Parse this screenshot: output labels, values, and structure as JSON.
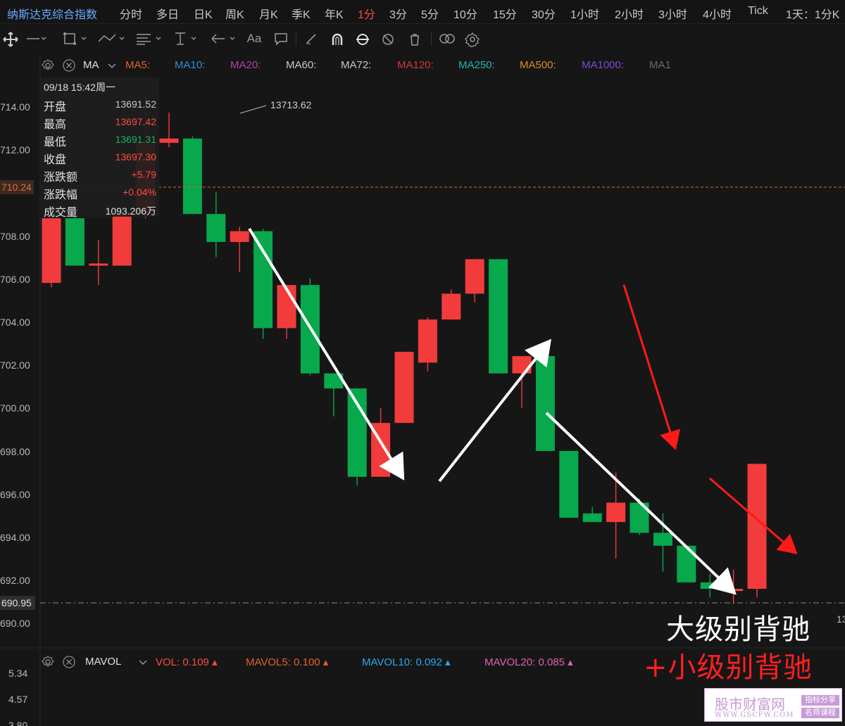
{
  "topbar": {
    "title": "纳斯达克综合指数",
    "timeframes": [
      "分时",
      "多日",
      "日K",
      "周K",
      "月K",
      "季K",
      "年K",
      "1分",
      "3分",
      "5分",
      "10分",
      "15分",
      "30分",
      "1小时",
      "2小时",
      "3小时",
      "4小时",
      "Tick"
    ],
    "active": "1分",
    "extra": "1天：1分K"
  },
  "indicator_legend": {
    "indicator": "MA",
    "items": [
      {
        "label": "MA5:",
        "color": "#e0632a"
      },
      {
        "label": "MA10:",
        "color": "#2f8fd8"
      },
      {
        "label": "MA20:",
        "color": "#b040a8"
      },
      {
        "label": "MA60:",
        "color": "#c8c8c8"
      },
      {
        "label": "MA72:",
        "color": "#c8c8c8"
      },
      {
        "label": "MA120:",
        "color": "#d03a3a"
      },
      {
        "label": "MA250:",
        "color": "#21b3b3"
      },
      {
        "label": "MA500:",
        "color": "#d9901e"
      },
      {
        "label": "MA1000:",
        "color": "#7b4ad8"
      },
      {
        "label": "MA1",
        "color": "#6a6a6a"
      }
    ]
  },
  "infobox": {
    "datetime": "09/18 15:42周一",
    "rows": [
      {
        "label": "开盘",
        "value": "13691.52",
        "color": "#c8c8c8"
      },
      {
        "label": "最高",
        "value": "13697.42",
        "color": "#ff4a3d"
      },
      {
        "label": "最低",
        "value": "13691.31",
        "color": "#19b35a"
      },
      {
        "label": "收盘",
        "value": "13697.30",
        "color": "#ff4a3d"
      },
      {
        "label": "涨跌额",
        "value": "+5.79",
        "color": "#ff4a3d"
      },
      {
        "label": "涨跌幅",
        "value": "+0.04%",
        "color": "#ff4a3d"
      },
      {
        "label": "成交量",
        "value": "1093.206万",
        "color": "#e0e0e0"
      }
    ]
  },
  "price_axis": {
    "ticks": [
      "714.00",
      "712.00",
      "708.00",
      "706.00",
      "704.00",
      "702.00",
      "700.00",
      "698.00",
      "696.00",
      "694.00",
      "692.00",
      "690.00"
    ],
    "current_label": "710.24",
    "last_label": "690.95"
  },
  "high_annotation": "13713.62",
  "volume_axis": [
    "5.34",
    "4.57",
    "3.80"
  ],
  "volume_legend": {
    "indicator": "MAVOL",
    "items": [
      {
        "label": "VOL:",
        "value": "0.109",
        "color": "#ff4a3d"
      },
      {
        "label": "MAVOL5:",
        "value": "0.100",
        "color": "#e0632a"
      },
      {
        "label": "MAVOL10:",
        "value": "0.092",
        "color": "#2aa8e8"
      },
      {
        "label": "MAVOL20:",
        "value": "0.085",
        "color": "#e060b0"
      }
    ]
  },
  "right_edge_label": "13",
  "overlay_text": {
    "line1": "大级别背驰",
    "line2": "+小级别背驰"
  },
  "watermark": {
    "title": "股市财富网",
    "url": "WWW.GSCFW.COM",
    "tag1": "指标分享",
    "tag2": "名师课程"
  },
  "colors": {
    "up": "#f23c3c",
    "down": "#08a84d",
    "background": "#161616"
  },
  "chart_data": {
    "type": "candlestick",
    "price_unit": "last 3 digits of index level",
    "ylim": [
      689.2,
      716.5
    ],
    "candles": [
      {
        "o": 705.8,
        "h": 708.8,
        "l": 705.6,
        "c": 708.8
      },
      {
        "o": 708.8,
        "h": 709.5,
        "l": 706.7,
        "c": 706.6
      },
      {
        "o": 706.6,
        "h": 707.8,
        "l": 705.7,
        "c": 706.7
      },
      {
        "o": 706.6,
        "h": 709.0,
        "l": 706.6,
        "c": 709.0
      },
      {
        "o": 709.0,
        "h": 714.5,
        "l": 708.8,
        "c": 712.3
      },
      {
        "o": 712.3,
        "h": 713.71,
        "l": 712.1,
        "c": 712.5
      },
      {
        "o": 712.5,
        "h": 712.6,
        "l": 709.0,
        "c": 709.0
      },
      {
        "o": 709.0,
        "h": 710.0,
        "l": 707.0,
        "c": 707.7
      },
      {
        "o": 707.7,
        "h": 708.4,
        "l": 706.3,
        "c": 708.2
      },
      {
        "o": 708.2,
        "h": 708.3,
        "l": 703.2,
        "c": 703.7
      },
      {
        "o": 703.7,
        "h": 705.7,
        "l": 703.2,
        "c": 705.7
      },
      {
        "o": 705.7,
        "h": 706.0,
        "l": 701.5,
        "c": 701.6
      },
      {
        "o": 701.6,
        "h": 701.6,
        "l": 699.6,
        "c": 700.9
      },
      {
        "o": 700.9,
        "h": 700.9,
        "l": 696.4,
        "c": 696.8
      },
      {
        "o": 696.8,
        "h": 700.0,
        "l": 696.8,
        "c": 699.3
      },
      {
        "o": 699.3,
        "h": 702.6,
        "l": 699.3,
        "c": 702.6
      },
      {
        "o": 702.1,
        "h": 704.2,
        "l": 701.7,
        "c": 704.1
      },
      {
        "o": 704.1,
        "h": 705.5,
        "l": 704.1,
        "c": 705.3
      },
      {
        "o": 705.3,
        "h": 706.9,
        "l": 704.9,
        "c": 706.9
      },
      {
        "o": 706.9,
        "h": 706.9,
        "l": 701.6,
        "c": 701.6
      },
      {
        "o": 701.6,
        "h": 702.4,
        "l": 700.0,
        "c": 702.4
      },
      {
        "o": 702.4,
        "h": 702.5,
        "l": 698.0,
        "c": 698.0
      },
      {
        "o": 698.0,
        "h": 698.0,
        "l": 694.9,
        "c": 694.9
      },
      {
        "o": 695.1,
        "h": 695.4,
        "l": 694.7,
        "c": 694.7
      },
      {
        "o": 694.7,
        "h": 697.0,
        "l": 693.0,
        "c": 695.6
      },
      {
        "o": 695.6,
        "h": 695.8,
        "l": 694.1,
        "c": 694.2
      },
      {
        "o": 694.2,
        "h": 695.1,
        "l": 692.4,
        "c": 693.6
      },
      {
        "o": 693.6,
        "h": 693.6,
        "l": 692.0,
        "c": 691.9
      },
      {
        "o": 691.9,
        "h": 692.3,
        "l": 691.2,
        "c": 691.6
      },
      {
        "o": 691.5,
        "h": 692.5,
        "l": 690.9,
        "c": 691.6
      },
      {
        "o": 691.6,
        "h": 697.4,
        "l": 691.2,
        "c": 697.4
      }
    ]
  }
}
